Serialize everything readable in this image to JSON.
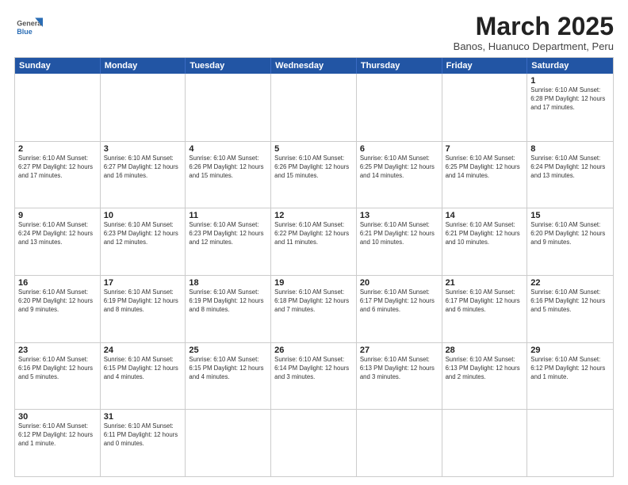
{
  "header": {
    "logo_general": "General",
    "logo_blue": "Blue",
    "title": "March 2025",
    "subtitle": "Banos, Huanuco Department, Peru"
  },
  "days_of_week": [
    "Sunday",
    "Monday",
    "Tuesday",
    "Wednesday",
    "Thursday",
    "Friday",
    "Saturday"
  ],
  "weeks": [
    [
      {
        "day": "",
        "info": ""
      },
      {
        "day": "",
        "info": ""
      },
      {
        "day": "",
        "info": ""
      },
      {
        "day": "",
        "info": ""
      },
      {
        "day": "",
        "info": ""
      },
      {
        "day": "",
        "info": ""
      },
      {
        "day": "1",
        "info": "Sunrise: 6:10 AM\nSunset: 6:28 PM\nDaylight: 12 hours\nand 17 minutes."
      }
    ],
    [
      {
        "day": "2",
        "info": "Sunrise: 6:10 AM\nSunset: 6:27 PM\nDaylight: 12 hours\nand 17 minutes."
      },
      {
        "day": "3",
        "info": "Sunrise: 6:10 AM\nSunset: 6:27 PM\nDaylight: 12 hours\nand 16 minutes."
      },
      {
        "day": "4",
        "info": "Sunrise: 6:10 AM\nSunset: 6:26 PM\nDaylight: 12 hours\nand 15 minutes."
      },
      {
        "day": "5",
        "info": "Sunrise: 6:10 AM\nSunset: 6:26 PM\nDaylight: 12 hours\nand 15 minutes."
      },
      {
        "day": "6",
        "info": "Sunrise: 6:10 AM\nSunset: 6:25 PM\nDaylight: 12 hours\nand 14 minutes."
      },
      {
        "day": "7",
        "info": "Sunrise: 6:10 AM\nSunset: 6:25 PM\nDaylight: 12 hours\nand 14 minutes."
      },
      {
        "day": "8",
        "info": "Sunrise: 6:10 AM\nSunset: 6:24 PM\nDaylight: 12 hours\nand 13 minutes."
      }
    ],
    [
      {
        "day": "9",
        "info": "Sunrise: 6:10 AM\nSunset: 6:24 PM\nDaylight: 12 hours\nand 13 minutes."
      },
      {
        "day": "10",
        "info": "Sunrise: 6:10 AM\nSunset: 6:23 PM\nDaylight: 12 hours\nand 12 minutes."
      },
      {
        "day": "11",
        "info": "Sunrise: 6:10 AM\nSunset: 6:23 PM\nDaylight: 12 hours\nand 12 minutes."
      },
      {
        "day": "12",
        "info": "Sunrise: 6:10 AM\nSunset: 6:22 PM\nDaylight: 12 hours\nand 11 minutes."
      },
      {
        "day": "13",
        "info": "Sunrise: 6:10 AM\nSunset: 6:21 PM\nDaylight: 12 hours\nand 10 minutes."
      },
      {
        "day": "14",
        "info": "Sunrise: 6:10 AM\nSunset: 6:21 PM\nDaylight: 12 hours\nand 10 minutes."
      },
      {
        "day": "15",
        "info": "Sunrise: 6:10 AM\nSunset: 6:20 PM\nDaylight: 12 hours\nand 9 minutes."
      }
    ],
    [
      {
        "day": "16",
        "info": "Sunrise: 6:10 AM\nSunset: 6:20 PM\nDaylight: 12 hours\nand 9 minutes."
      },
      {
        "day": "17",
        "info": "Sunrise: 6:10 AM\nSunset: 6:19 PM\nDaylight: 12 hours\nand 8 minutes."
      },
      {
        "day": "18",
        "info": "Sunrise: 6:10 AM\nSunset: 6:19 PM\nDaylight: 12 hours\nand 8 minutes."
      },
      {
        "day": "19",
        "info": "Sunrise: 6:10 AM\nSunset: 6:18 PM\nDaylight: 12 hours\nand 7 minutes."
      },
      {
        "day": "20",
        "info": "Sunrise: 6:10 AM\nSunset: 6:17 PM\nDaylight: 12 hours\nand 6 minutes."
      },
      {
        "day": "21",
        "info": "Sunrise: 6:10 AM\nSunset: 6:17 PM\nDaylight: 12 hours\nand 6 minutes."
      },
      {
        "day": "22",
        "info": "Sunrise: 6:10 AM\nSunset: 6:16 PM\nDaylight: 12 hours\nand 5 minutes."
      }
    ],
    [
      {
        "day": "23",
        "info": "Sunrise: 6:10 AM\nSunset: 6:16 PM\nDaylight: 12 hours\nand 5 minutes."
      },
      {
        "day": "24",
        "info": "Sunrise: 6:10 AM\nSunset: 6:15 PM\nDaylight: 12 hours\nand 4 minutes."
      },
      {
        "day": "25",
        "info": "Sunrise: 6:10 AM\nSunset: 6:15 PM\nDaylight: 12 hours\nand 4 minutes."
      },
      {
        "day": "26",
        "info": "Sunrise: 6:10 AM\nSunset: 6:14 PM\nDaylight: 12 hours\nand 3 minutes."
      },
      {
        "day": "27",
        "info": "Sunrise: 6:10 AM\nSunset: 6:13 PM\nDaylight: 12 hours\nand 3 minutes."
      },
      {
        "day": "28",
        "info": "Sunrise: 6:10 AM\nSunset: 6:13 PM\nDaylight: 12 hours\nand 2 minutes."
      },
      {
        "day": "29",
        "info": "Sunrise: 6:10 AM\nSunset: 6:12 PM\nDaylight: 12 hours\nand 1 minute."
      }
    ],
    [
      {
        "day": "30",
        "info": "Sunrise: 6:10 AM\nSunset: 6:12 PM\nDaylight: 12 hours\nand 1 minute."
      },
      {
        "day": "31",
        "info": "Sunrise: 6:10 AM\nSunset: 6:11 PM\nDaylight: 12 hours\nand 0 minutes."
      },
      {
        "day": "",
        "info": ""
      },
      {
        "day": "",
        "info": ""
      },
      {
        "day": "",
        "info": ""
      },
      {
        "day": "",
        "info": ""
      },
      {
        "day": "",
        "info": ""
      }
    ]
  ]
}
